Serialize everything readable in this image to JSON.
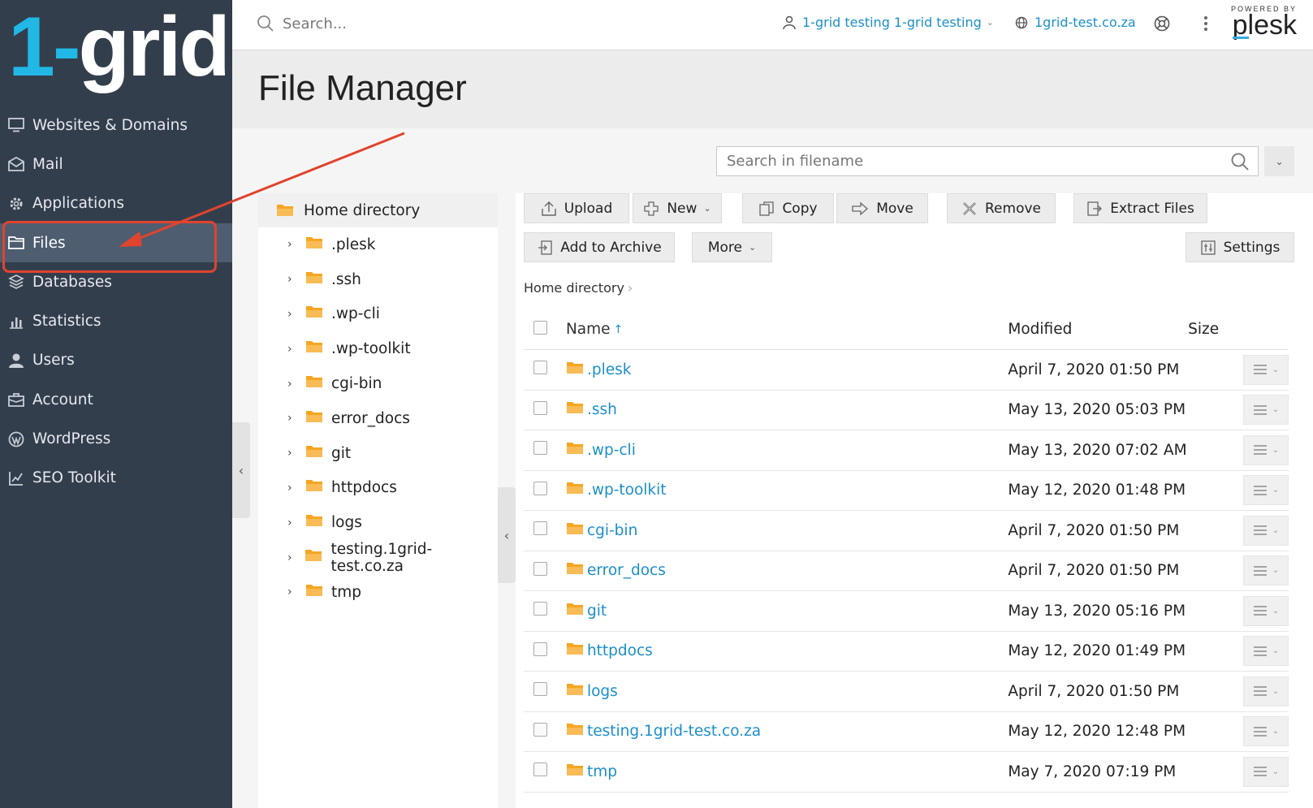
{
  "brand": {
    "logo_one": "1",
    "logo_dash": "-",
    "logo_grid": "grid"
  },
  "sidebar": {
    "items": [
      {
        "label": "Websites & Domains",
        "icon": "monitor-icon"
      },
      {
        "label": "Mail",
        "icon": "envelope-icon"
      },
      {
        "label": "Applications",
        "icon": "gear-icon"
      },
      {
        "label": "Files",
        "icon": "folder-icon",
        "active": true
      },
      {
        "label": "Databases",
        "icon": "database-icon"
      },
      {
        "label": "Statistics",
        "icon": "bar-chart-icon"
      },
      {
        "label": "Users",
        "icon": "user-icon"
      },
      {
        "label": "Account",
        "icon": "account-icon"
      },
      {
        "label": "WordPress",
        "icon": "wordpress-icon"
      },
      {
        "label": "SEO Toolkit",
        "icon": "seo-chart-icon"
      }
    ]
  },
  "topbar": {
    "search_placeholder": "Search...",
    "user_label": "1-grid testing 1-grid testing",
    "domain_label": "1grid-test.co.za",
    "powered_by": "POWERED BY",
    "plesk_brand": "plesk"
  },
  "page": {
    "title": "File Manager"
  },
  "filename_search": {
    "placeholder": "Search in filename"
  },
  "toolbar": {
    "upload": "Upload",
    "new": "New",
    "copy": "Copy",
    "move": "Move",
    "remove": "Remove",
    "extract": "Extract Files",
    "archive": "Add to Archive",
    "more": "More",
    "settings": "Settings"
  },
  "tree": {
    "root": "Home directory",
    "items": [
      ".plesk",
      ".ssh",
      ".wp-cli",
      ".wp-toolkit",
      "cgi-bin",
      "error_docs",
      "git",
      "httpdocs",
      "logs",
      "testing.1grid-test.co.za",
      "tmp"
    ]
  },
  "breadcrumb": {
    "current": "Home directory",
    "separator": "›"
  },
  "table": {
    "headers": {
      "name": "Name",
      "sort": "↑",
      "modified": "Modified",
      "size": "Size"
    },
    "rows": [
      {
        "name": ".plesk",
        "modified": "April 7, 2020 01:50 PM"
      },
      {
        "name": ".ssh",
        "modified": "May 13, 2020 05:03 PM"
      },
      {
        "name": ".wp-cli",
        "modified": "May 13, 2020 07:02 AM"
      },
      {
        "name": ".wp-toolkit",
        "modified": "May 12, 2020 01:48 PM"
      },
      {
        "name": "cgi-bin",
        "modified": "April 7, 2020 01:50 PM"
      },
      {
        "name": "error_docs",
        "modified": "April 7, 2020 01:50 PM"
      },
      {
        "name": "git",
        "modified": "May 13, 2020 05:16 PM"
      },
      {
        "name": "httpdocs",
        "modified": "May 12, 2020 01:49 PM"
      },
      {
        "name": "logs",
        "modified": "April 7, 2020 01:50 PM"
      },
      {
        "name": "testing.1grid-test.co.za",
        "modified": "May 12, 2020 12:48 PM"
      },
      {
        "name": "tmp",
        "modified": "May 7, 2020 07:19 PM"
      }
    ]
  },
  "colors": {
    "sidebar": "#333e4d",
    "link": "#1b8fc9",
    "folder": "#f5a623",
    "annotation": "#e0442e",
    "logo_accent": "#21b8e6"
  }
}
